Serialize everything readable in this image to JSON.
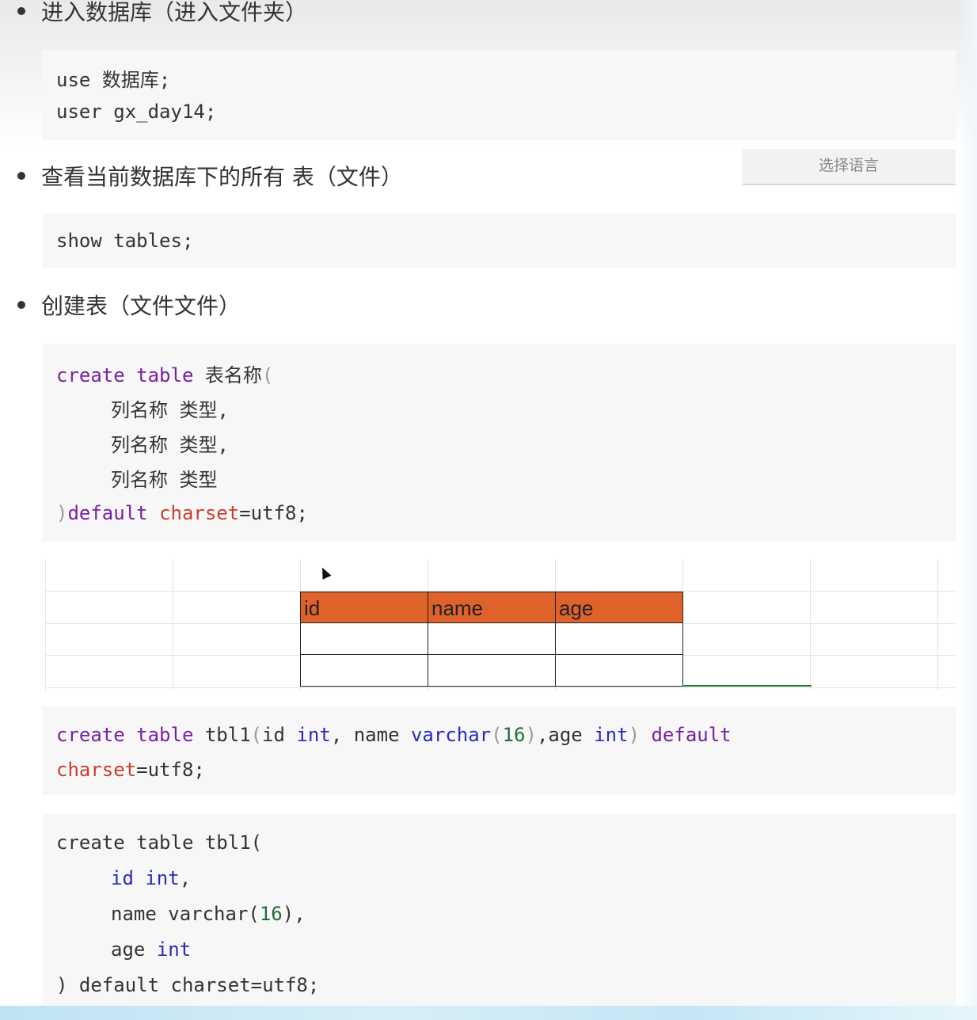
{
  "sections": [
    {
      "title": "进入数据库（进入文件夹）"
    },
    {
      "title": "查看当前数据库下的所有 表（文件）"
    },
    {
      "title": "创建表（文件文件）"
    }
  ],
  "code1": {
    "line1": "use 数据库;",
    "line2": "user gx_day14;"
  },
  "language_selector": {
    "label": "选择语言"
  },
  "code2": {
    "line1": "show tables;"
  },
  "code3": {
    "create": "create",
    "table": "table",
    "name": "表名称",
    "paren_open": "(",
    "col_line1": "列名称 类型,",
    "col_line2": "列名称 类型,",
    "col_line3": "列名称 类型",
    "paren_close": ")",
    "default": "default",
    "charset": "charset",
    "eq_utf8": "=utf8;"
  },
  "spreadsheet": {
    "headers": [
      "id",
      "name",
      "age"
    ]
  },
  "code4": {
    "create": "create",
    "table": "table",
    "tbl": "tbl1",
    "p1": "(",
    "id": "id ",
    "int1": "int",
    "comma1": ", name ",
    "varchar": "varchar",
    "p2": "(",
    "n16": "16",
    "p3": ")",
    "age": ",age ",
    "int2": "int",
    "p4": ")",
    "default": "default",
    "charset": "charset",
    "eq_utf8": "=utf8;"
  },
  "code5": {
    "line1": "create table tbl1(",
    "id": "id",
    "int1": "int",
    "comma": ",",
    "name_pre": "name varchar(",
    "n16": "16",
    "name_post": "),",
    "age": "age",
    "int2": "int",
    "line5": ") default charset=utf8;"
  }
}
